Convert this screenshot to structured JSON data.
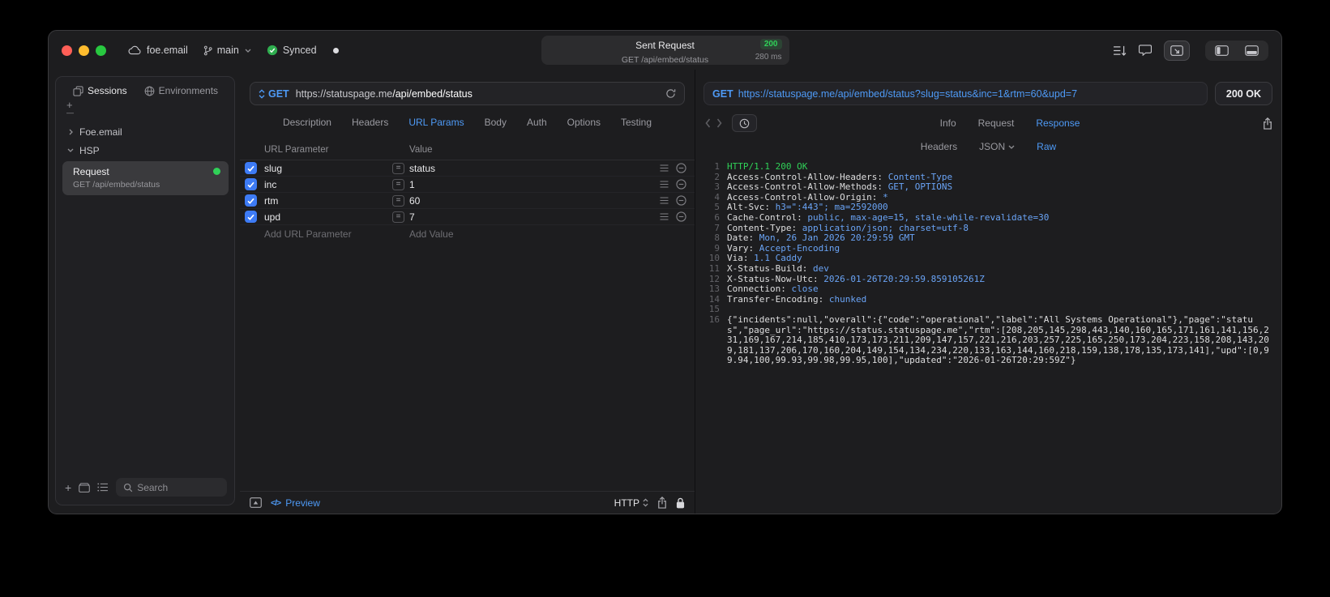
{
  "colors": {
    "accent": "#4e9af6",
    "green": "#30d158",
    "value_blue": "#6aa4f6",
    "checkbox": "#3d7bf5",
    "traffic_red": "#ff5f57",
    "traffic_yellow": "#febc2e",
    "traffic_green": "#28c840"
  },
  "titlebar": {
    "project": "foe.email",
    "branch": "main",
    "sync": "Synced",
    "center": {
      "title": "Sent Request",
      "code": "200",
      "request": "GET /api/embed/status",
      "time": "280 ms"
    }
  },
  "sidebar": {
    "tab_sessions": "Sessions",
    "tab_environments": "Environments",
    "group1": "Foe.email",
    "group2": "HSP",
    "request_name": "Request",
    "request_sub": "GET /api/embed/status",
    "search_placeholder": "Search"
  },
  "request": {
    "method": "GET",
    "url_host": "https://statuspage.me",
    "url_path": "/api/embed/status",
    "tabs": [
      "Description",
      "Headers",
      "URL Params",
      "Body",
      "Auth",
      "Options",
      "Testing"
    ],
    "active_tab": "URL Params",
    "col_param": "URL Parameter",
    "col_value": "Value",
    "params": [
      {
        "name": "slug",
        "value": "status",
        "checked": true
      },
      {
        "name": "inc",
        "value": "1",
        "checked": true
      },
      {
        "name": "rtm",
        "value": "60",
        "checked": true
      },
      {
        "name": "upd",
        "value": "7",
        "checked": true
      }
    ],
    "add_param_placeholder": "Add URL Parameter",
    "add_value_placeholder": "Add Value",
    "footer": {
      "preview_icon": "</>",
      "preview": "Preview",
      "protocol": "HTTP"
    }
  },
  "response": {
    "method": "GET",
    "url": "https://statuspage.me/api/embed/status?slug=status&inc=1&rtm=60&upd=7",
    "status": "200 OK",
    "tabs": [
      "Info",
      "Request",
      "Response"
    ],
    "active_tab": "Response",
    "subtabs": [
      {
        "label": "Headers",
        "dropdown": false,
        "active": false
      },
      {
        "label": "JSON",
        "dropdown": true,
        "active": false
      },
      {
        "label": "Raw",
        "dropdown": false,
        "active": true
      }
    ],
    "body_lines": [
      {
        "n": "1",
        "parts": [
          {
            "t": "HTTP/1.1 200 OK",
            "cls": "green"
          }
        ]
      },
      {
        "n": "2",
        "parts": [
          {
            "t": "Access-Control-Allow-Headers: "
          },
          {
            "t": "Content-Type",
            "cls": "blue"
          }
        ]
      },
      {
        "n": "3",
        "parts": [
          {
            "t": "Access-Control-Allow-Methods: "
          },
          {
            "t": "GET, OPTIONS",
            "cls": "blue"
          }
        ]
      },
      {
        "n": "4",
        "parts": [
          {
            "t": "Access-Control-Allow-Origin: "
          },
          {
            "t": "*",
            "cls": "blue"
          }
        ]
      },
      {
        "n": "5",
        "parts": [
          {
            "t": "Alt-Svc: "
          },
          {
            "t": "h3=\":443\"; ma=2592000",
            "cls": "blue"
          }
        ]
      },
      {
        "n": "6",
        "parts": [
          {
            "t": "Cache-Control: "
          },
          {
            "t": "public, max-age=15, stale-while-revalidate=30",
            "cls": "blue"
          }
        ]
      },
      {
        "n": "7",
        "parts": [
          {
            "t": "Content-Type: "
          },
          {
            "t": "application/json; charset=utf-8",
            "cls": "blue"
          }
        ]
      },
      {
        "n": "8",
        "parts": [
          {
            "t": "Date: "
          },
          {
            "t": "Mon, 26 Jan 2026 20:29:59 GMT",
            "cls": "blue"
          }
        ]
      },
      {
        "n": "9",
        "parts": [
          {
            "t": "Vary: "
          },
          {
            "t": "Accept-Encoding",
            "cls": "blue"
          }
        ]
      },
      {
        "n": "10",
        "parts": [
          {
            "t": "Via: "
          },
          {
            "t": "1.1 Caddy",
            "cls": "blue"
          }
        ]
      },
      {
        "n": "11",
        "parts": [
          {
            "t": "X-Status-Build: "
          },
          {
            "t": "dev",
            "cls": "blue"
          }
        ]
      },
      {
        "n": "12",
        "parts": [
          {
            "t": "X-Status-Now-Utc: "
          },
          {
            "t": "2026-01-26T20:29:59.859105261Z",
            "cls": "blue"
          }
        ]
      },
      {
        "n": "13",
        "parts": [
          {
            "t": "Connection: "
          },
          {
            "t": "close",
            "cls": "blue"
          }
        ]
      },
      {
        "n": "14",
        "parts": [
          {
            "t": "Transfer-Encoding: "
          },
          {
            "t": "chunked",
            "cls": "blue"
          }
        ]
      },
      {
        "n": "15",
        "parts": []
      },
      {
        "n": "16",
        "parts": [
          {
            "t": "{\"incidents\":null,\"overall\":{\"code\":\"operational\",\"label\":\"All Systems Operational\"},\"page\":\"status\",\"page_url\":\"https://status.statuspage.me\",\"rtm\":[208,205,145,298,443,140,160,165,171,161,141,156,231,169,167,214,185,410,173,173,211,209,147,157,221,216,203,257,225,165,250,173,204,223,158,208,143,209,181,137,206,170,160,204,149,154,134,234,220,133,163,144,160,218,159,138,178,135,173,141],\"upd\":[0,99.94,100,99.93,99.98,99.95,100],\"updated\":\"2026-01-26T20:29:59Z\"}"
          }
        ]
      }
    ]
  }
}
